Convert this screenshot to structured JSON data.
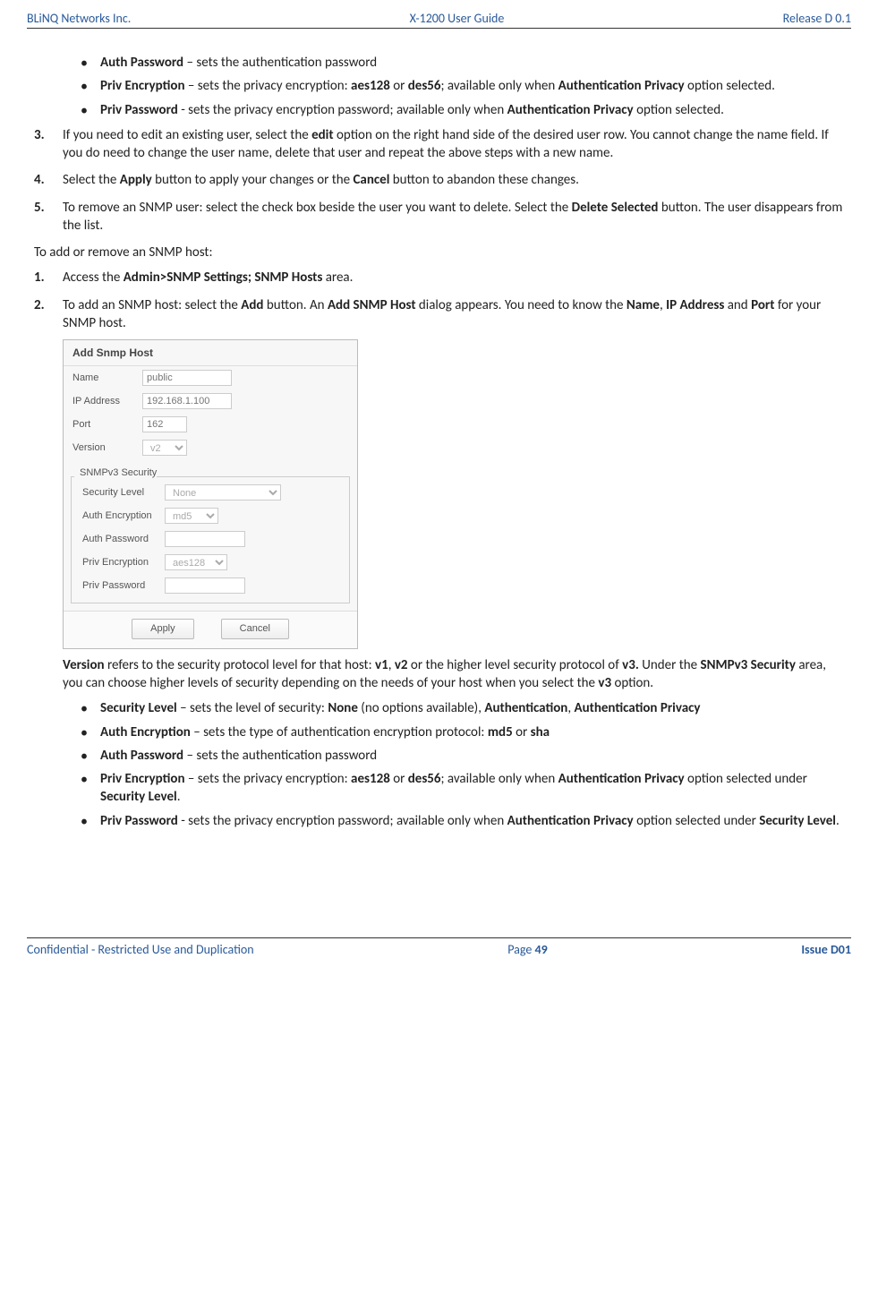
{
  "header": {
    "left": "BLiNQ Networks Inc.",
    "center": "X-1200 User Guide",
    "right": "Release D 0.1"
  },
  "top_bullets": [
    {
      "b": "Auth Password",
      "t": " – sets the authentication password"
    },
    {
      "b": "Priv Encryption",
      "mid": " – sets the privacy encryption: ",
      "b2": "aes128",
      "mid2": " or ",
      "b3": "des56",
      "mid3": "; available only when ",
      "b4": "Authentication Privacy",
      "t": " option selected."
    },
    {
      "b": "Priv Password",
      "mid": " - sets the privacy encryption password; available only when ",
      "b2": "Authentication Privacy",
      "t": " option selected."
    }
  ],
  "steps_a": {
    "s3": {
      "pre": "If you need to edit an existing user, select the ",
      "b1": "edit",
      "post": " option on the right hand side of the desired user row. You cannot change the name field. If you do need to change the user name, delete that user and repeat the above steps with a new name."
    },
    "s4": {
      "pre": "Select the ",
      "b1": "Apply",
      "mid": " button to apply your changes or the ",
      "b2": "Cancel",
      "post": " button to abandon these changes."
    },
    "s5": {
      "pre": "To remove an SNMP user: select the check box beside the user you want to delete. Select the ",
      "b1": "Delete Selected",
      "post": " button. The user disappears from the list."
    }
  },
  "intro2": "To add or remove an SNMP host:",
  "steps_b": {
    "s1": {
      "pre": "Access the ",
      "b1": "Admin>SNMP Settings; SNMP Hosts",
      "post": " area."
    },
    "s2": {
      "pre": "To add an SNMP host: select the ",
      "b1": "Add",
      "mid": " button. An ",
      "b2": "Add SNMP Host",
      "mid2": " dialog appears. You need to know the ",
      "b3": "Name",
      "mid3": ", ",
      "b4": "IP Address",
      "mid4": " and ",
      "b5": "Port",
      "post": " for your SNMP host."
    }
  },
  "dialog": {
    "title": "Add Snmp Host",
    "name_label": "Name",
    "name_ph": "public",
    "ip_label": "IP Address",
    "ip_ph": "192.168.1.100",
    "port_label": "Port",
    "port_ph": "162",
    "version_label": "Version",
    "version_val": "v2",
    "fs_title": "SNMPv3 Security",
    "sec_level_label": "Security Level",
    "sec_level_val": "None",
    "auth_enc_label": "Auth Encryption",
    "auth_enc_val": "md5",
    "auth_pw_label": "Auth Password",
    "priv_enc_label": "Priv Encryption",
    "priv_enc_val": "aes128",
    "priv_pw_label": "Priv Password",
    "apply": "Apply",
    "cancel": "Cancel"
  },
  "version_para": {
    "b1": "Version",
    "t1": " refers to the security protocol level for that host: ",
    "b2": "v1",
    "t2": ", ",
    "b3": "v2",
    "t3": " or the higher level security protocol of ",
    "b4": "v3.",
    "t4": " Under the ",
    "b5": "SNMPv3 Security",
    "t5": " area, you can choose higher levels of security depending on the needs of your host when you select the ",
    "b6": "v3",
    "t6": " option."
  },
  "bottom_bullets": [
    {
      "b": "Security Level",
      "t": " – sets the level of security: ",
      "b2": "None",
      "t2": " (no options available), ",
      "b3": "Authentication",
      "t3": ", ",
      "b4": "Authentication Privacy"
    },
    {
      "b": "Auth Encryption",
      "t": " – sets the type of authentication encryption protocol: ",
      "b2": "md5",
      "t2": " or ",
      "b3": "sha"
    },
    {
      "b": "Auth Password",
      "t": " – sets the authentication password"
    },
    {
      "b": "Priv Encryption",
      "t": " – sets the privacy encryption: ",
      "b2": "aes128",
      "t2": " or ",
      "b3": "des56",
      "t3": "; available only when ",
      "b4": "Authentication Privacy",
      "t4": " option selected under ",
      "b5": "Security Level",
      "t5": "."
    },
    {
      "b": "Priv Password",
      "t": " - sets the privacy encryption password; available only when ",
      "b2": "Authentication Privacy",
      "t2": " option selected under ",
      "b3": "Security Level",
      "t3": "."
    }
  ],
  "footer": {
    "left": "Confidential - Restricted Use and Duplication",
    "page_label": "Page ",
    "page_num": "49",
    "right": "Issue D01"
  }
}
